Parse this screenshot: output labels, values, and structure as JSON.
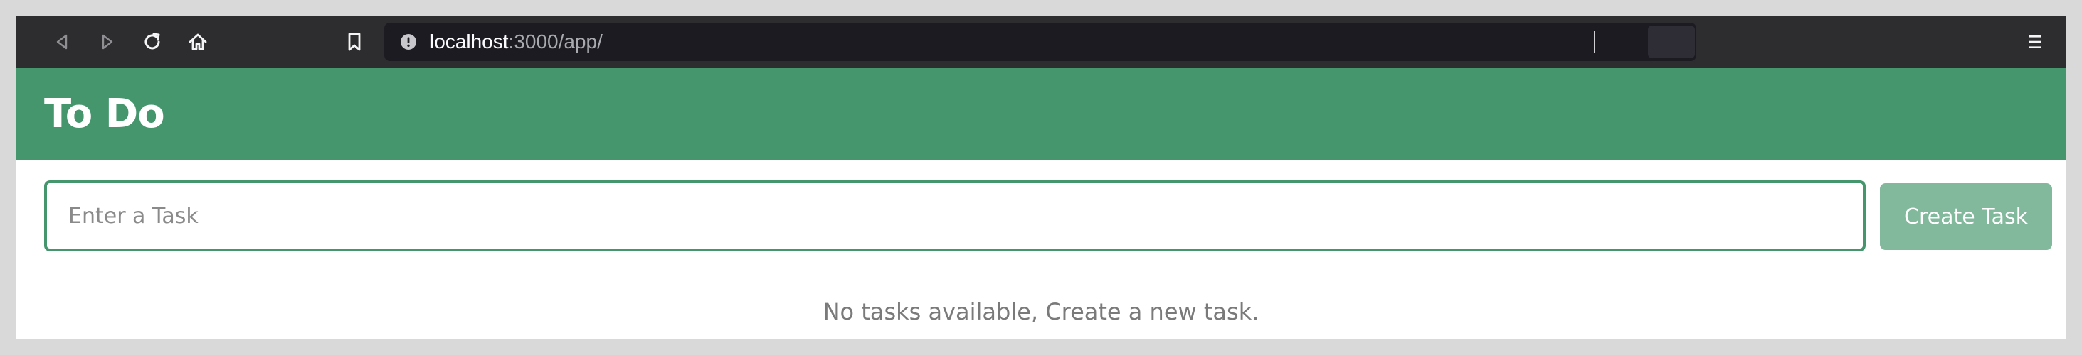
{
  "browser": {
    "url_host": "localhost",
    "url_path": ":3000/app/",
    "icons": {
      "back": "back-arrow-icon",
      "forward": "forward-arrow-icon",
      "reload": "reload-icon",
      "home": "home-icon",
      "bookmark": "bookmark-icon",
      "site_info": "info-icon",
      "menu": "hamburger-menu-icon"
    },
    "colors": {
      "toolbar": "#2d2d2f",
      "urlbar": "#1c1b22"
    }
  },
  "app": {
    "title": "To Do",
    "header_color": "#45956d"
  },
  "form": {
    "input_placeholder": "Enter a Task",
    "input_value": "",
    "create_button_label": "Create Task",
    "button_color": "#82b89c"
  },
  "task_list": {
    "empty_message": "No tasks available, Create a new task.",
    "tasks": []
  }
}
